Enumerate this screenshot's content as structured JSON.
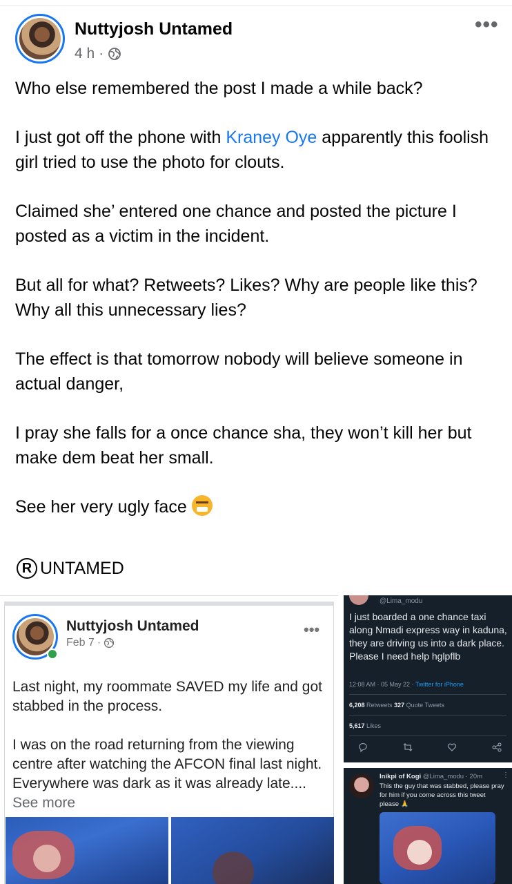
{
  "post": {
    "author": "Nuttyjosh Untamed",
    "time": "4 h",
    "separator": "·",
    "icon": "globe-icon",
    "more": "•••",
    "paragraphs": {
      "p1": "Who else remembered the post I made a while back?",
      "p2_before": "I just got off the phone with ",
      "p2_mention": "Kraney Oye",
      "p2_after": " apparently this foolish girl tried to use the photo for clouts.",
      "p3": "Claimed she’ entered one chance and posted the picture I posted as a victim in the incident.",
      "p4": "But all for what? Retweets? Likes? Why are people like this? Why all this unnecessary lies?",
      "p5": "The effect is that tomorrow nobody will believe someone in actual danger,",
      "p6": "I pray she falls for a once chance sha, they won’t kill her but make dem beat her small.",
      "p7": "See her very ugly face"
    },
    "emoji": "angry-face-emoji",
    "brand_symbol": "R",
    "brand": "UNTAMED",
    "accent": "#1877f2"
  },
  "embedded_post": {
    "author": "Nuttyjosh Untamed",
    "date": "Feb 7",
    "separator": "·",
    "more": "•••",
    "p1": "Last night, my roommate SAVED my life and got stabbed in the process.",
    "p2": "I was on the road returning from the viewing centre after watching the AFCON final last night. Everywhere was dark as it was already late....",
    "see_more": " See more"
  },
  "tweet1": {
    "handle": "@Lima_modu",
    "text": "I just boarded a one chance taxi along Nmadi express way in kaduna, they are driving us into a dark place. Please I need help hglpflb",
    "time": "12:08 AM · 05 May 22 · ",
    "source": "Twitter for iPhone",
    "retweets_count": "6,208",
    "retweets_label": " Retweets ",
    "quotes_count": "327",
    "quotes_label": " Quote Tweets",
    "likes_count": "5,617",
    "likes_label": " Likes"
  },
  "tweet2": {
    "name": "Inikpi of Kogi",
    "handle": " @Lima_modu · 20m",
    "more": "⋮",
    "text": "This the guy that was stabbed, please pray for him if you come across this tweet please 🙏"
  }
}
